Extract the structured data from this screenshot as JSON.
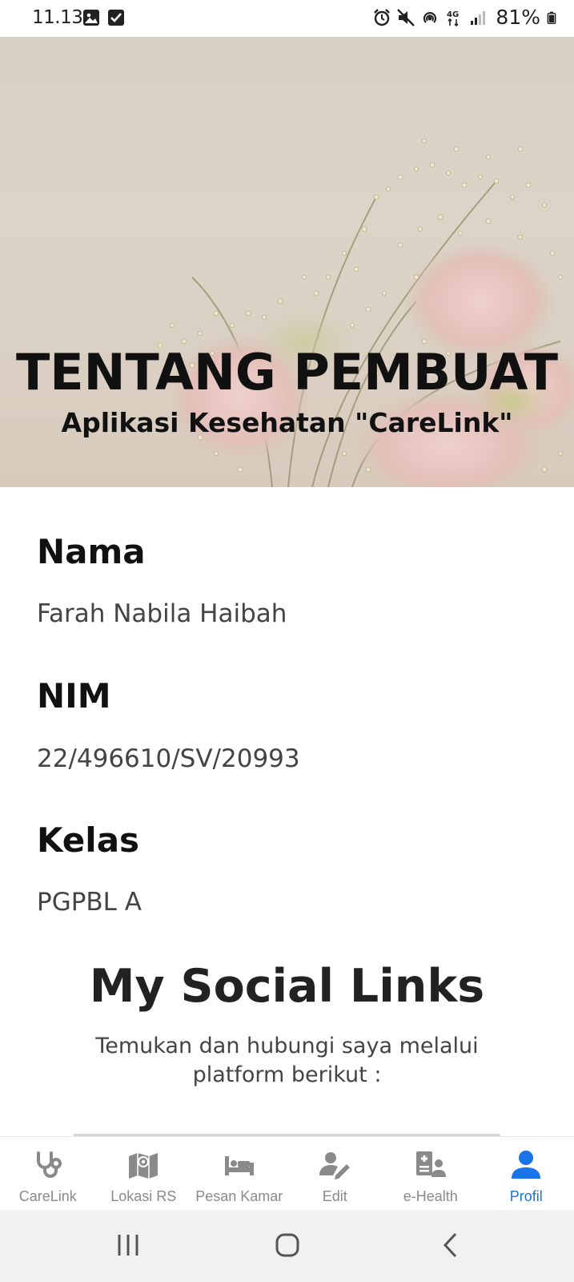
{
  "status_bar": {
    "time": "11.13",
    "battery": "81%",
    "icons": [
      "gallery-icon",
      "check-icon",
      "alarm-icon",
      "mute-icon",
      "hotspot-icon",
      "4g-icon",
      "signal-icon",
      "battery-icon"
    ]
  },
  "hero": {
    "title": "TENTANG PEMBUAT",
    "subtitle": "Aplikasi Kesehatan \"CareLink\""
  },
  "profile": {
    "name_label": "Nama",
    "name_value": "Farah Nabila Haibah",
    "nim_label": "NIM",
    "nim_value": "22/496610/SV/20993",
    "class_label": "Kelas",
    "class_value": "PGPBL A"
  },
  "social": {
    "title": "My Social Links",
    "description": "Temukan dan hubungi saya melalui platform berikut :"
  },
  "bottom_nav": {
    "items": [
      {
        "label": "CareLink",
        "icon": "stethoscope-icon"
      },
      {
        "label": "Lokasi RS",
        "icon": "map-icon"
      },
      {
        "label": "Pesan Kamar",
        "icon": "bed-icon"
      },
      {
        "label": "Edit",
        "icon": "user-edit-icon"
      },
      {
        "label": "e-Health",
        "icon": "medical-record-icon"
      },
      {
        "label": "Profil",
        "icon": "person-icon"
      }
    ],
    "active": "Profil",
    "active_color": "#1a73e8",
    "inactive_color": "#8a8a8a"
  },
  "system_nav": {
    "icons": [
      "recent-apps-icon",
      "home-icon",
      "back-icon"
    ]
  }
}
